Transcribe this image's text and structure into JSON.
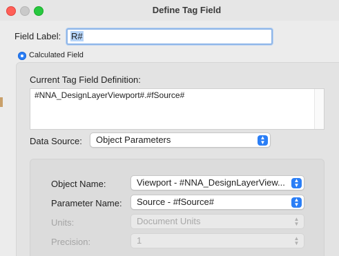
{
  "window": {
    "title": "Define Tag Field"
  },
  "field_label": {
    "label": "Field Label:",
    "value": "R#"
  },
  "mode": {
    "calculated_label": "Calculated Field"
  },
  "definition": {
    "label": "Current Tag Field Definition:",
    "value": "#NNA_DesignLayerViewport#.#fSource#"
  },
  "data_source": {
    "label": "Data Source:",
    "value": "Object Parameters"
  },
  "params": {
    "object_name": {
      "label": "Object Name:",
      "value": "Viewport - #NNA_DesignLayerView..."
    },
    "parameter_name": {
      "label": "Parameter Name:",
      "value": "Source - #fSource#"
    },
    "units": {
      "label": "Units:",
      "value": "Document Units"
    },
    "precision": {
      "label": "Precision:",
      "value": "1"
    }
  },
  "icons": {
    "close": "close-icon",
    "minimize": "minimize-icon",
    "maximize": "maximize-icon",
    "radio": "radio-selected-icon",
    "popup": "chevron-up-down-icon"
  },
  "colors": {
    "accent": "#2a7ef6",
    "close": "#ff5f57",
    "maximize": "#28c840"
  }
}
